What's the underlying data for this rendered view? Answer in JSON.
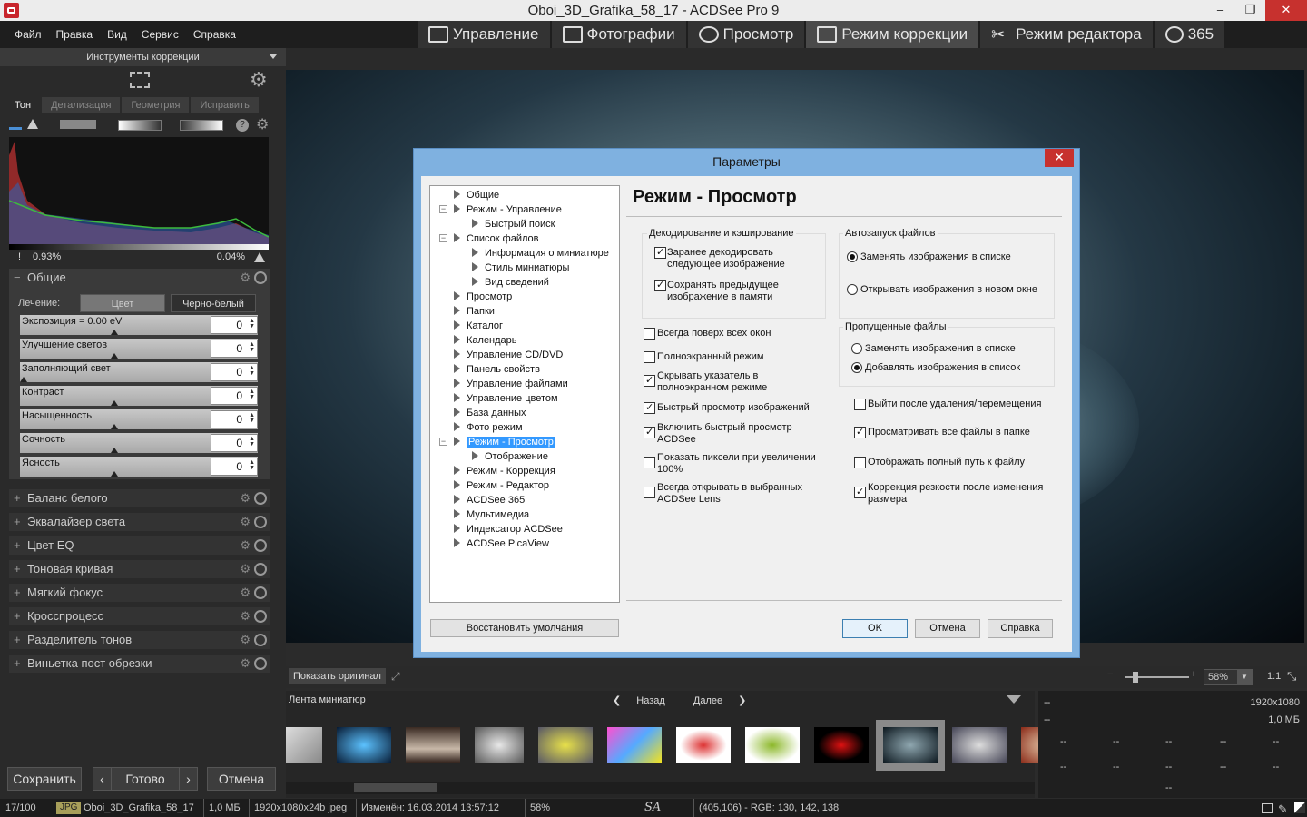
{
  "window": {
    "title": "Oboi_3D_Grafika_58_17 - ACDSee Pro 9",
    "minimize": "–",
    "maximize": "❐",
    "close": "✕"
  },
  "menu": [
    "Файл",
    "Правка",
    "Вид",
    "Сервис",
    "Справка"
  ],
  "modes": [
    "Управление",
    "Фотографии",
    "Просмотр",
    "Режим коррекции",
    "Режим редактора",
    "365"
  ],
  "left": {
    "header": "Инструменты коррекции",
    "tabs": [
      "Тон",
      "Детализация",
      "Геометрия",
      "Исправить"
    ],
    "hist_left": "0.93%",
    "hist_right": "0.04%",
    "general": {
      "title": "Общие",
      "treat_label": "Лечение:",
      "treat_color": "Цвет",
      "treat_bw": "Черно-белый",
      "sliders": [
        {
          "label": "Экспозиция = 0.00 eV",
          "value": "0"
        },
        {
          "label": "Улучшение светов",
          "value": "0"
        },
        {
          "label": "Заполняющий свет",
          "value": "0"
        },
        {
          "label": "Контраст",
          "value": "0"
        },
        {
          "label": "Насыщенность",
          "value": "0"
        },
        {
          "label": "Сочность",
          "value": "0"
        },
        {
          "label": "Ясность",
          "value": "0"
        }
      ]
    },
    "sections": [
      "Баланс белого",
      "Эквалайзер света",
      "Цвет EQ",
      "Тоновая кривая",
      "Мягкий фокус",
      "Кросспроцесс",
      "Разделитель тонов",
      "Виньетка пост обрезки"
    ],
    "save": "Сохранить",
    "done": "Готово",
    "cancel": "Отмена"
  },
  "viewer": {
    "show_original": "Показать оригинал",
    "zoom": "58%",
    "one_to_one": "1:1"
  },
  "filmstrip": {
    "title": "Лента миниатюр",
    "back": "Назад",
    "next": "Далее"
  },
  "info": {
    "res": "1920x1080",
    "size": "1,0 МБ",
    "dash": "--"
  },
  "status": {
    "count": "17/100",
    "type": "JPG",
    "name": "Oboi_3D_Grafika_58_17",
    "size": "1,0 МБ",
    "dims": "1920x1080x24b jpeg",
    "modified": "Изменён: 16.03.2014 13:57:12",
    "zoom": "58%",
    "coords": "(405,106) - RGB: 130, 142, 138"
  },
  "dialog": {
    "title": "Параметры",
    "close": "✕",
    "panel_title": "Режим - Просмотр",
    "tree": [
      "Общие",
      "Режим - Управление",
      "Быстрый поиск",
      "Список файлов",
      "Информация о миниатюре",
      "Стиль миниатюры",
      "Вид сведений",
      "Просмотр",
      "Папки",
      "Каталог",
      "Календарь",
      "Управление CD/DVD",
      "Панель свойств",
      "Управление файлами",
      "Управление цветом",
      "База данных",
      "Фото режим",
      "Режим - Просмотр",
      "Отображение",
      "Режим - Коррекция",
      "Режим - Редактор",
      "ACDSee 365",
      "Мультимедиа",
      "Индексатор ACDSee",
      "ACDSee PicaView"
    ],
    "group_decode": "Декодирование и кэширование",
    "decode_next": "Заранее декодировать следующее изображение",
    "keep_prev": "Сохранять предыдущее изображение в памяти",
    "group_autostart": "Автозапуск файлов",
    "replace_list": "Заменять изображения в списке",
    "open_new": "Открывать изображения в новом окне",
    "group_skipped": "Пропущенные файлы",
    "skip_replace": "Заменять изображения в списке",
    "skip_add": "Добавлять изображения в список",
    "always_top": "Всегда поверх всех окон",
    "fullscreen": "Полноэкранный режим",
    "hide_pointer": "Скрывать указатель в полноэкранном режиме",
    "quick_view": "Быстрый просмотр изображений",
    "quick_acdsee": "Включить быстрый просмотр ACDSee",
    "show_pixels": "Показать пиксели при увеличении 100%",
    "open_lens": "Всегда открывать в выбранных ACDSee Lens",
    "exit_after": "Выйти после удаления/перемещения",
    "view_all": "Просматривать все файлы в папке",
    "full_path": "Отображать полный путь к файлу",
    "sharpen": "Коррекция резкости после изменения размера",
    "restore": "Восстановить умолчания",
    "ok": "OK",
    "cancel": "Отмена",
    "help": "Справка"
  }
}
